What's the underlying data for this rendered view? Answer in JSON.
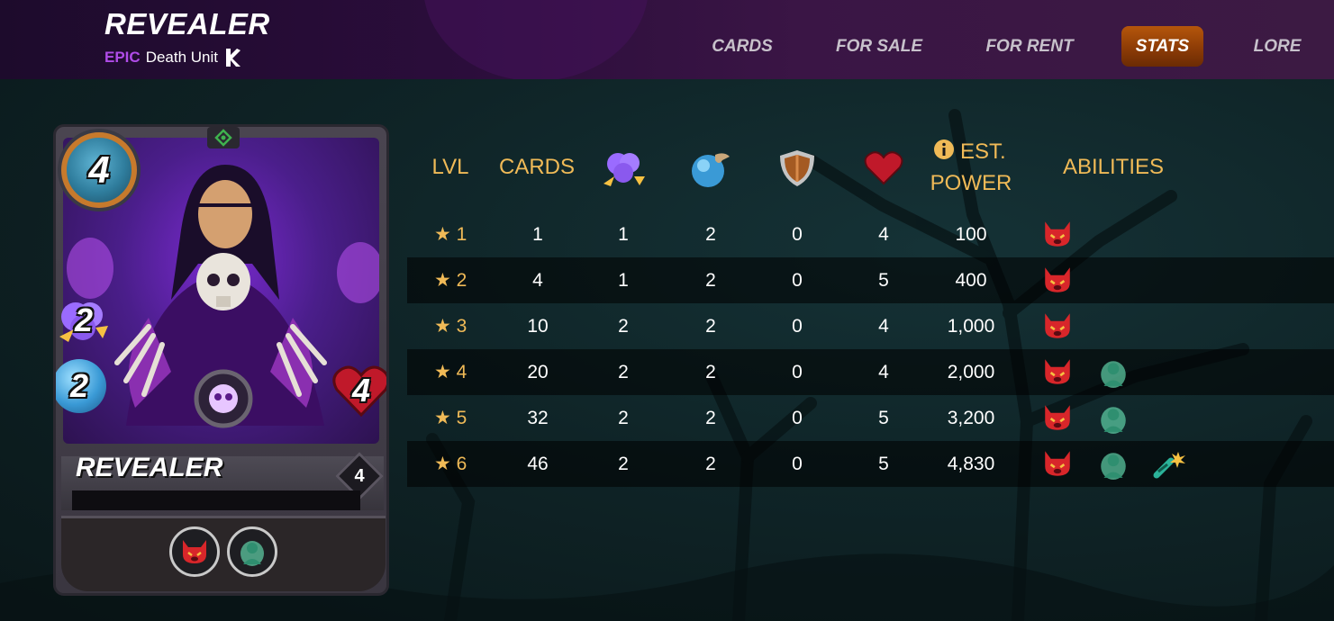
{
  "header": {
    "title": "REVEALER",
    "rarity": "EPIC",
    "unit_type": "Death Unit"
  },
  "nav": [
    {
      "label": "CARDS",
      "active": false
    },
    {
      "label": "FOR SALE",
      "active": false
    },
    {
      "label": "FOR RENT",
      "active": false
    },
    {
      "label": "STATS",
      "active": true
    },
    {
      "label": "LORE",
      "active": false
    }
  ],
  "card": {
    "name": "REVEALER",
    "mana": "4",
    "magic": "2",
    "speed": "2",
    "health": "4",
    "level": "4",
    "abilities": [
      "demoralize-icon",
      "reveal-icon"
    ]
  },
  "table": {
    "headers": {
      "lvl": "LVL",
      "cards": "CARDS",
      "magic_icon": "magic-icon",
      "speed_icon": "speed-icon",
      "armor_icon": "armor-icon",
      "health_icon": "health-icon",
      "power_line1": "EST.",
      "power_line2": "POWER",
      "abilities": "ABILITIES"
    },
    "rows": [
      {
        "level": "1",
        "cards": "1",
        "magic": "1",
        "speed": "2",
        "armor": "0",
        "health": "4",
        "power": "100",
        "abilities": [
          "demoralize-icon"
        ]
      },
      {
        "level": "2",
        "cards": "4",
        "magic": "1",
        "speed": "2",
        "armor": "0",
        "health": "5",
        "power": "400",
        "abilities": [
          "demoralize-icon"
        ]
      },
      {
        "level": "3",
        "cards": "10",
        "magic": "2",
        "speed": "2",
        "armor": "0",
        "health": "4",
        "power": "1,000",
        "abilities": [
          "demoralize-icon"
        ]
      },
      {
        "level": "4",
        "cards": "20",
        "magic": "2",
        "speed": "2",
        "armor": "0",
        "health": "4",
        "power": "2,000",
        "abilities": [
          "demoralize-icon",
          "reveal-icon"
        ]
      },
      {
        "level": "5",
        "cards": "32",
        "magic": "2",
        "speed": "2",
        "armor": "0",
        "health": "5",
        "power": "3,200",
        "abilities": [
          "demoralize-icon",
          "reveal-icon"
        ]
      },
      {
        "level": "6",
        "cards": "46",
        "magic": "2",
        "speed": "2",
        "armor": "0",
        "health": "5",
        "power": "4,830",
        "abilities": [
          "demoralize-icon",
          "reveal-icon",
          "blast-icon"
        ]
      }
    ]
  },
  "colors": {
    "gold": "#f0ba57",
    "epic": "#b04ce8",
    "active_tab": "#b5560b"
  }
}
